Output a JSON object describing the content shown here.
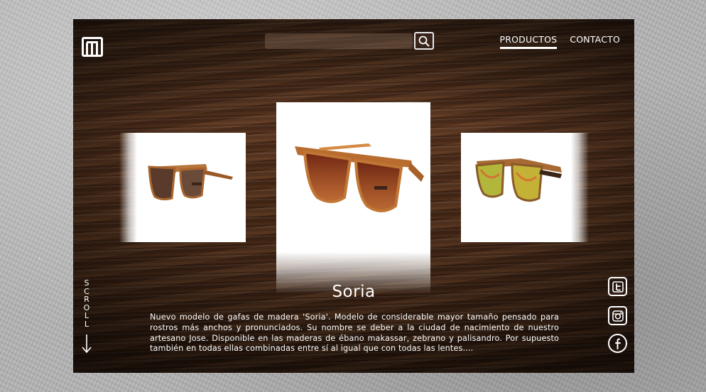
{
  "header": {
    "logo_icon": "m-logo-icon",
    "search": {
      "placeholder": "",
      "value": "",
      "button_icon": "search-icon"
    },
    "nav": [
      {
        "label": "PRODUCTOS",
        "active": true
      },
      {
        "label": "CONTACTO",
        "active": false
      }
    ]
  },
  "carousel": {
    "items": [
      {
        "position": "left",
        "image": "wooden-sunglasses-brown-lens"
      },
      {
        "position": "center",
        "image": "wooden-sunglasses-soria-gradient-lens"
      },
      {
        "position": "right",
        "image": "wooden-sunglasses-yellow-mirror-lens"
      }
    ]
  },
  "product": {
    "title": "Soria",
    "description": "Nuevo modelo de gafas de madera 'Soria'.  Modelo de considerable mayor tamaño pensado para rostros más anchos y pronunciados.  Su nombre se deber a la ciudad de nacimiento de nuestro artesano Jose.  Disponible en las maderas de ébano makassar, zebrano y palisandro. Por supuesto también en todas ellas combinadas entre sí al igual que con todas las lentes...."
  },
  "scroll": {
    "label": "SCROLL",
    "arrow_icon": "arrow-down-icon"
  },
  "social": [
    {
      "name": "twitter",
      "icon": "twitter-icon"
    },
    {
      "name": "instagram",
      "icon": "instagram-icon"
    },
    {
      "name": "facebook",
      "icon": "facebook-icon"
    }
  ],
  "colors": {
    "background": "#b3b3b3",
    "wood": "#4d2d1a",
    "text": "#ffffff"
  }
}
